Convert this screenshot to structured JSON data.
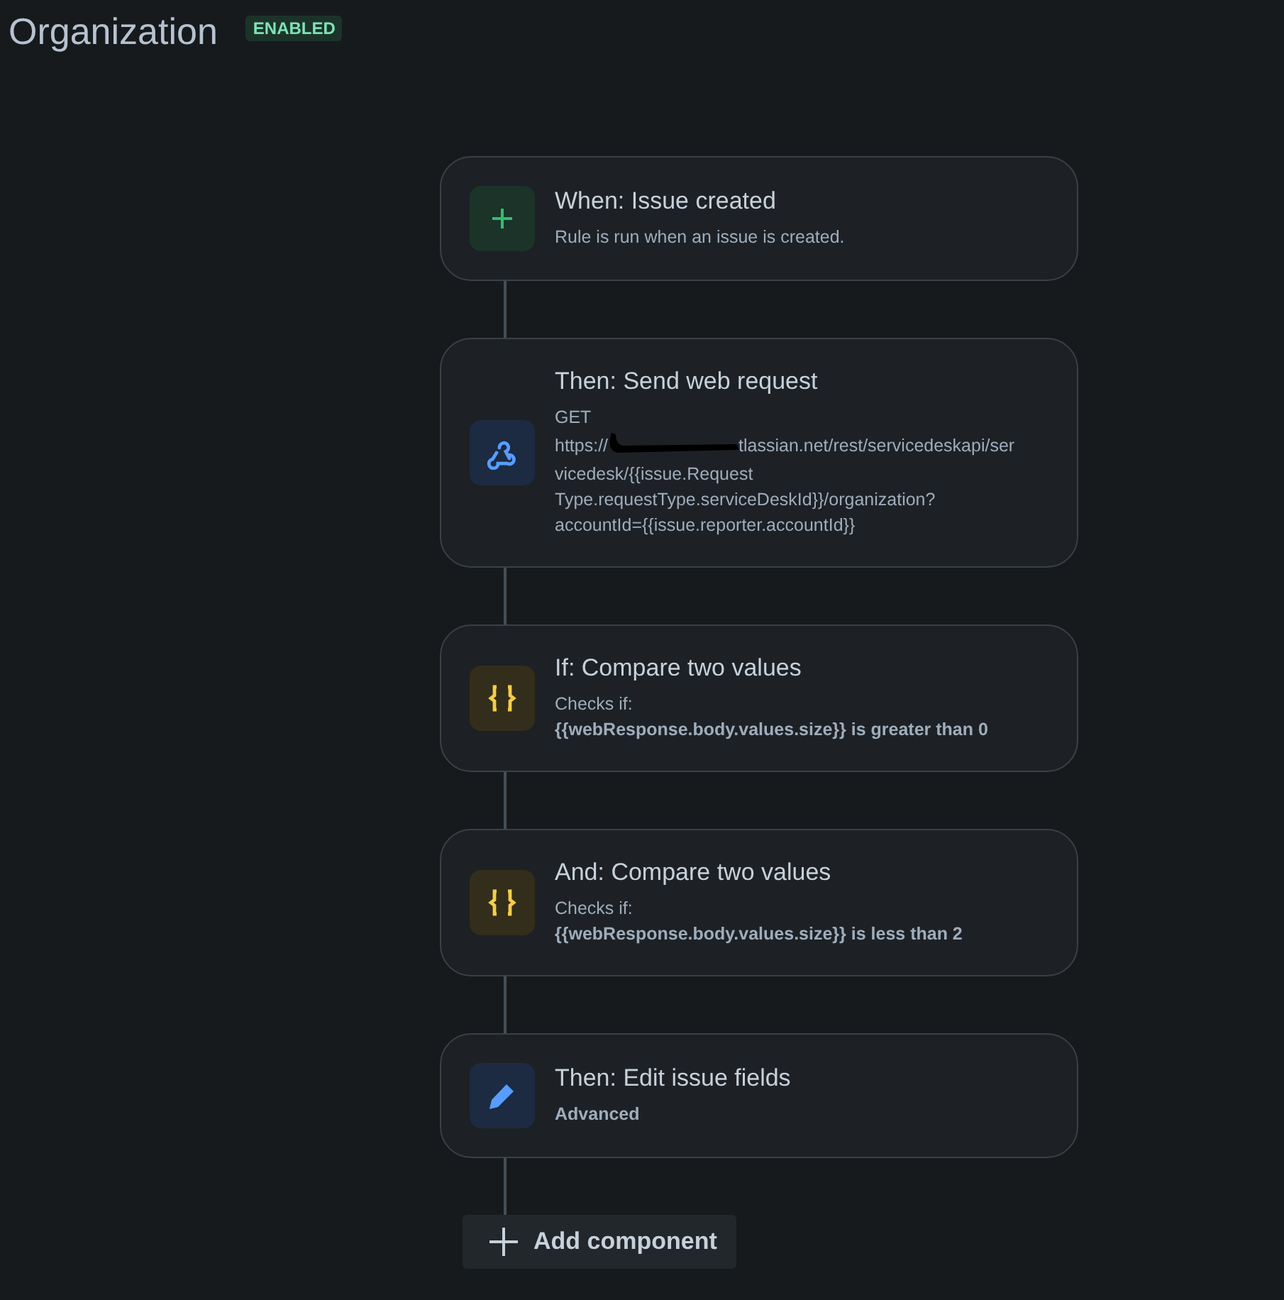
{
  "header": {
    "title": "Organization",
    "status": "ENABLED"
  },
  "cards": [
    {
      "kind": "plus",
      "title": "When: Issue created",
      "lines": [
        {
          "text": "Rule is run when an issue is created.",
          "bold": false
        }
      ]
    },
    {
      "kind": "webhook",
      "title": "Then: Send web request",
      "lines": [
        {
          "text": "GET",
          "bold": false
        },
        {
          "kind": "redacted",
          "text": "https://",
          "after": "tlassian.net/rest/servicedeskapi/ser",
          "bold": false
        },
        {
          "text": "vicedesk/{{issue.Request",
          "bold": false
        },
        {
          "text": "Type.requestType.serviceDeskId}}/organization?",
          "bold": false
        },
        {
          "text": "accountId={{issue.reporter.accountId}}",
          "bold": false
        }
      ]
    },
    {
      "kind": "braces",
      "title": "If: Compare two values",
      "lines": [
        {
          "text": "Checks if:",
          "bold": false
        },
        {
          "text": "{{webResponse.body.values.size}} is greater than 0",
          "bold": true
        }
      ]
    },
    {
      "kind": "braces",
      "title": "And: Compare two values",
      "lines": [
        {
          "text": "Checks if:",
          "bold": false
        },
        {
          "text": "{{webResponse.body.values.size}} is less than 2",
          "bold": true
        }
      ]
    },
    {
      "kind": "pencil",
      "title": "Then: Edit issue fields",
      "lines": [
        {
          "text": "Advanced",
          "bold": true
        }
      ]
    }
  ],
  "add_button": {
    "label": "Add component"
  }
}
